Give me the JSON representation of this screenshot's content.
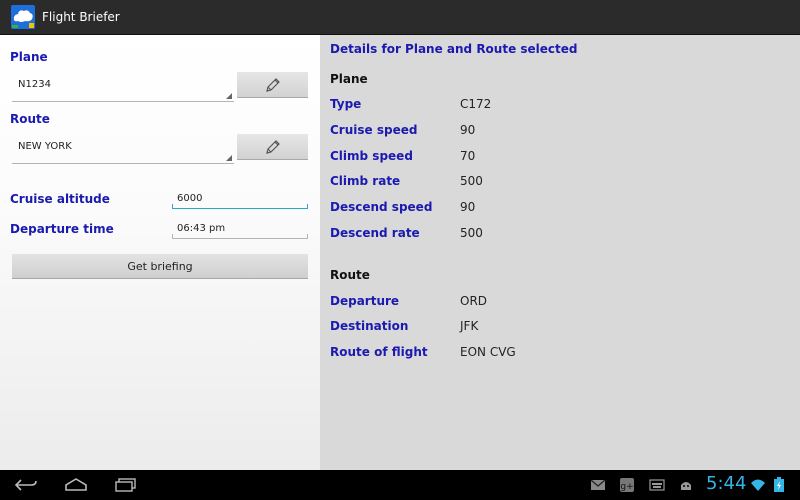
{
  "app": {
    "title": "Flight Briefer",
    "icon": "cloud-app-icon"
  },
  "left": {
    "plane_label": "Plane",
    "plane_value": "N1234",
    "route_label": "Route",
    "route_value": "NEW YORK",
    "cruise_altitude_label": "Cruise altitude",
    "cruise_altitude_value": "6000",
    "departure_time_label": "Departure time",
    "departure_time_value": "06:43 pm",
    "briefing_button": "Get briefing"
  },
  "right": {
    "title": "Details for Plane and Route selected",
    "plane_section": "Plane",
    "plane_rows": [
      {
        "label": "Type",
        "value": "C172"
      },
      {
        "label": "Cruise speed",
        "value": "90"
      },
      {
        "label": "Climb speed",
        "value": "70"
      },
      {
        "label": "Climb rate",
        "value": "500"
      },
      {
        "label": "Descend speed",
        "value": "90"
      },
      {
        "label": "Descend rate",
        "value": "500"
      }
    ],
    "route_section": "Route",
    "route_rows": [
      {
        "label": "Departure",
        "value": "ORD"
      },
      {
        "label": "Destination",
        "value": "JFK"
      },
      {
        "label": "Route of flight",
        "value": "EON CVG"
      }
    ]
  },
  "system": {
    "time": "5:44"
  },
  "colors": {
    "accent": "#33b5e5",
    "label_blue": "#1a1ab0",
    "action_bar": "#2b2b2b"
  }
}
